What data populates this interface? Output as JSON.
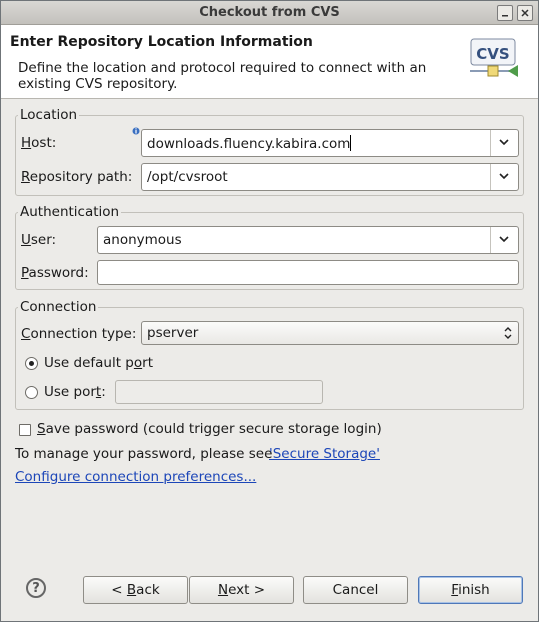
{
  "window": {
    "title": "Checkout from CVS"
  },
  "header": {
    "title": "Enter Repository Location Information",
    "description": "Define the location and protocol required to connect with an existing CVS repository.",
    "logo_text": "CVS"
  },
  "location": {
    "legend": "Location",
    "host_label": "Host:",
    "host_value": "downloads.fluency.kabira.com",
    "path_label": "Repository path:",
    "path_value": "/opt/cvsroot",
    "info_icon": "info-icon"
  },
  "authentication": {
    "legend": "Authentication",
    "user_label": "User:",
    "user_value": "anonymous",
    "password_label": "Password:",
    "password_value": ""
  },
  "connection": {
    "legend": "Connection",
    "type_label": "Connection type:",
    "type_value": "pserver",
    "default_port_label": "Use default port",
    "use_port_label": "Use port:",
    "port_value": ""
  },
  "save_password_label": "Save password (could trigger secure storage login)",
  "manage_text": "To manage your password, please see ",
  "secure_storage_link": "'Secure Storage'",
  "configure_link": "Configure connection preferences...",
  "buttons": {
    "help": "?",
    "back": "< Back",
    "next": "Next >",
    "cancel": "Cancel",
    "finish": "Finish"
  },
  "colors": {
    "link": "#1c46b8",
    "default_button_border": "#4f78b8"
  }
}
